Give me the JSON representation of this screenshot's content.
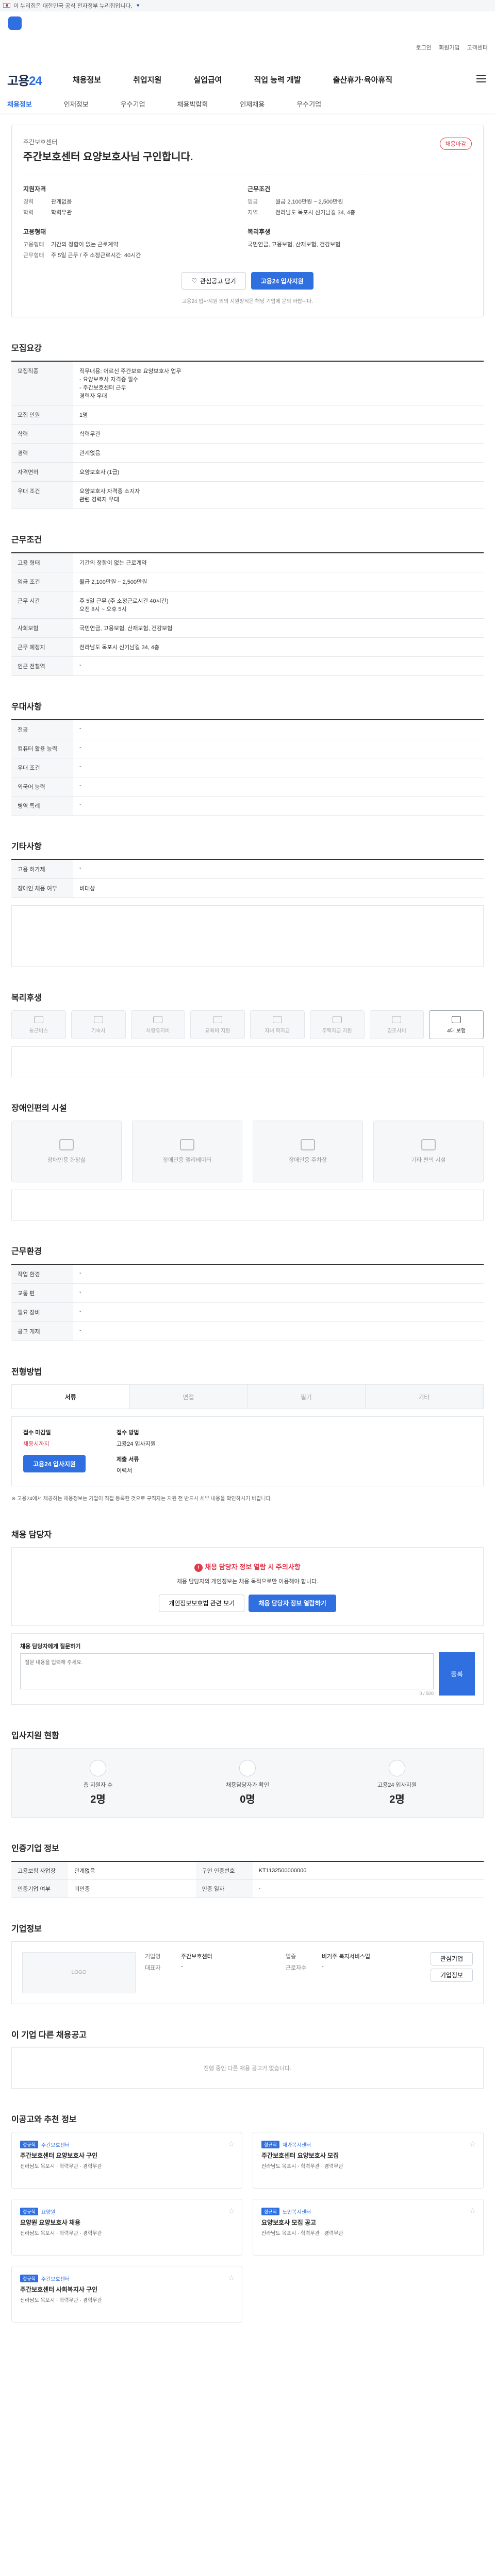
{
  "topbar": {
    "text": "이 누리집은 대한민국 공식 전자정부 누리집입니다.",
    "expand": ""
  },
  "header": {
    "util": [
      "로그인",
      "회원가입",
      "고객센터"
    ],
    "brand_a": "고용",
    "brand_b": "24",
    "nav": [
      "채용정보",
      "취업지원",
      "실업급여",
      "직업 능력 개발",
      "출산휴가·육아휴직"
    ],
    "subnav": [
      "채용정보",
      "인재정보",
      "우수기업",
      "채용박람회",
      "인재채용",
      "우수기업"
    ]
  },
  "summary": {
    "company": "주간보호센터",
    "title": "주간보호센터 요양보호사님 구인합니다.",
    "badge": "채용마감",
    "cols": [
      {
        "h": "지원자격",
        "rows": [
          [
            "경력",
            "관계없음"
          ],
          [
            "학력",
            "학력무관"
          ]
        ]
      },
      {
        "h": "근무조건",
        "rows": [
          [
            "임금",
            "월급 2,100만원 ~ 2,500만원"
          ],
          [
            "지역",
            "전라남도 목포시 신기남길 34, 4층"
          ]
        ]
      }
    ],
    "cols2": [
      {
        "h": "고용형태",
        "rows": [
          [
            "고용형태",
            "기간의 정함이 없는 근로계약"
          ],
          [
            "근무형태",
            "주 5일 근무 / 주 소정근로시간: 40시간"
          ]
        ]
      },
      {
        "h": "복리후생",
        "rows": [
          [
            "",
            "국민연금, 고용보험, 산재보험, 건강보험"
          ]
        ]
      }
    ],
    "btn_interest": "관심공고 담기",
    "btn_apply": "고용24 입사지원",
    "notice": "고용24 입사지원 외의 지원방식은 해당 기업에 문의 바랍니다."
  },
  "sections": {
    "recruit": "모집요강",
    "work": "근무조건",
    "prefer": "우대사항",
    "etc": "기타사항",
    "welfare": "복리후생",
    "disability": "장애인편의 시설",
    "location": "근무환경",
    "method": "전형방법",
    "contact": "채용 담당자",
    "stats": "입사지원 현황",
    "info": "인증기업 정보",
    "company": "기업정보",
    "others": "이 기업 다른 채용공고",
    "recommend": "이공고와 추천 정보"
  },
  "recruit_table": [
    [
      "모집직종",
      "직무내용: 어르신 주간보호 요양보호사 업무\n- 요양보호사 자격증 필수\n- 주간보호센터 근무\n경력자 우대"
    ],
    [
      "모집 인원",
      "1명"
    ],
    [
      "학력",
      "학력무관"
    ],
    [
      "경력",
      "관계없음"
    ],
    [
      "자격면허",
      "요양보호사 (1급)"
    ],
    [
      "우대 조건",
      "요양보호사 자격증 소지자\n관련 경력자 우대"
    ]
  ],
  "work_table": [
    [
      "고용 형태",
      "기간의 정함이 없는 근로계약"
    ],
    [
      "임금 조건",
      "월급 2,100만원 ~ 2,500만원"
    ],
    [
      "근무 시간",
      "주 5일 근무 (주 소정근로시간 40시간)\n오전 8시 ~ 오후 5시"
    ],
    [
      "사회보험",
      "국민연금, 고용보험, 산재보험, 건강보험"
    ],
    [
      "근무 예정지",
      "전라남도 목포시 신기남길 34, 4층"
    ],
    [
      "인근 전철역",
      "-"
    ]
  ],
  "prefer_table": [
    [
      "전공",
      "-"
    ],
    [
      "컴퓨터 활용 능력",
      "-"
    ],
    [
      "우대 조건",
      "-"
    ],
    [
      "외국어 능력",
      "-"
    ],
    [
      "병역 특례",
      "-"
    ]
  ],
  "etc_table": [
    [
      "고용 허가제",
      "-"
    ],
    [
      "장애인 채용 여부",
      "비대상"
    ]
  ],
  "welfare_items": [
    {
      "label": "통근버스",
      "on": false
    },
    {
      "label": "기숙사",
      "on": false
    },
    {
      "label": "차량유지비",
      "on": false
    },
    {
      "label": "교육비 지원",
      "on": false
    },
    {
      "label": "자녀 학자금",
      "on": false
    },
    {
      "label": "주택자금 지원",
      "on": false
    },
    {
      "label": "경조사비",
      "on": false
    },
    {
      "label": "4대 보험",
      "on": true
    }
  ],
  "disability_items": [
    "장애인용 화장실",
    "장애인용 엘리베이터",
    "장애인용 주차장",
    "기타 편의 시설"
  ],
  "location_table": [
    [
      "작업 환경",
      "-"
    ],
    [
      "교통 편",
      "-"
    ],
    [
      "필요 장비",
      "-"
    ],
    [
      "공고 게재",
      "-"
    ]
  ],
  "method": {
    "tabs": [
      "서류",
      "면접",
      "필기",
      "기타"
    ],
    "col1_h": "접수 마감일",
    "col1_v": "채용시까지",
    "col2_h": "접수 방법",
    "col2_v": "고용24 입사지원",
    "col3_h": "제출 서류",
    "col3_v": "이력서",
    "apply_btn": "고용24 입사지원",
    "notes": "※ 고용24에서 제공하는 채용정보는 기업이 직접 등록한 것으로 구직자는 지원 전 반드시 세부 내용을 확인하시기 바랍니다."
  },
  "contact": {
    "alert": "채용 담당자 정보 열람 시 주의사항",
    "body": "채용 담당자의 개인정보는 채용 목적으로만 이용해야 합니다.",
    "btn1": "개인정보보호법 관련 보기",
    "btn2": "채용 담당자 정보 열람하기",
    "q_label": "채용 담당자에게 질문하기",
    "q_placeholder": "질문 내용을 입력해 주세요.",
    "q_btn": "등록",
    "count": "0 / 500"
  },
  "stats": [
    {
      "label": "총 지원자 수",
      "value": "2명"
    },
    {
      "label": "채용담당자가 확인",
      "value": "0명"
    },
    {
      "label": "고용24 입사지원",
      "value": "2명"
    }
  ],
  "info_table": [
    [
      "고용보험 사업장",
      "관계없음",
      "구인 인증번호",
      "KT1132500000000"
    ],
    [
      "인증기업 여부",
      "미인증",
      "인증 일자",
      "-"
    ]
  ],
  "company": {
    "logo_text": "LOGO",
    "fields": [
      [
        "기업명",
        "주간보호센터"
      ],
      [
        "업종",
        "비거주 복지서비스업"
      ],
      [
        "대표자",
        "-"
      ],
      [
        "근로자수",
        "-"
      ]
    ],
    "btn_follow": "관심기업",
    "btn_more": "기업정보"
  },
  "others_empty": "진행 중인 다른 채용 공고가 없습니다.",
  "recommend": [
    {
      "tag": "정규직",
      "corp": "주간보호센터",
      "title": "주간보호센터 요양보호사 구인",
      "meta": "전라남도 목포시 · 학력무관 · 경력무관"
    },
    {
      "tag": "정규직",
      "corp": "재가복지센터",
      "title": "주간보호센터 요양보호사 모집",
      "meta": "전라남도 목포시 · 학력무관 · 경력무관"
    },
    {
      "tag": "정규직",
      "corp": "요양원",
      "title": "요양원 요양보호사 채용",
      "meta": "전라남도 목포시 · 학력무관 · 경력무관"
    },
    {
      "tag": "정규직",
      "corp": "노인복지센터",
      "title": "요양보호사 모집 공고",
      "meta": "전라남도 목포시 · 학력무관 · 경력무관"
    },
    {
      "tag": "정규직",
      "corp": "주간보호센터",
      "title": "주간보호센터 사회복지사 구인",
      "meta": "전라남도 목포시 · 학력무관 · 경력무관"
    }
  ]
}
